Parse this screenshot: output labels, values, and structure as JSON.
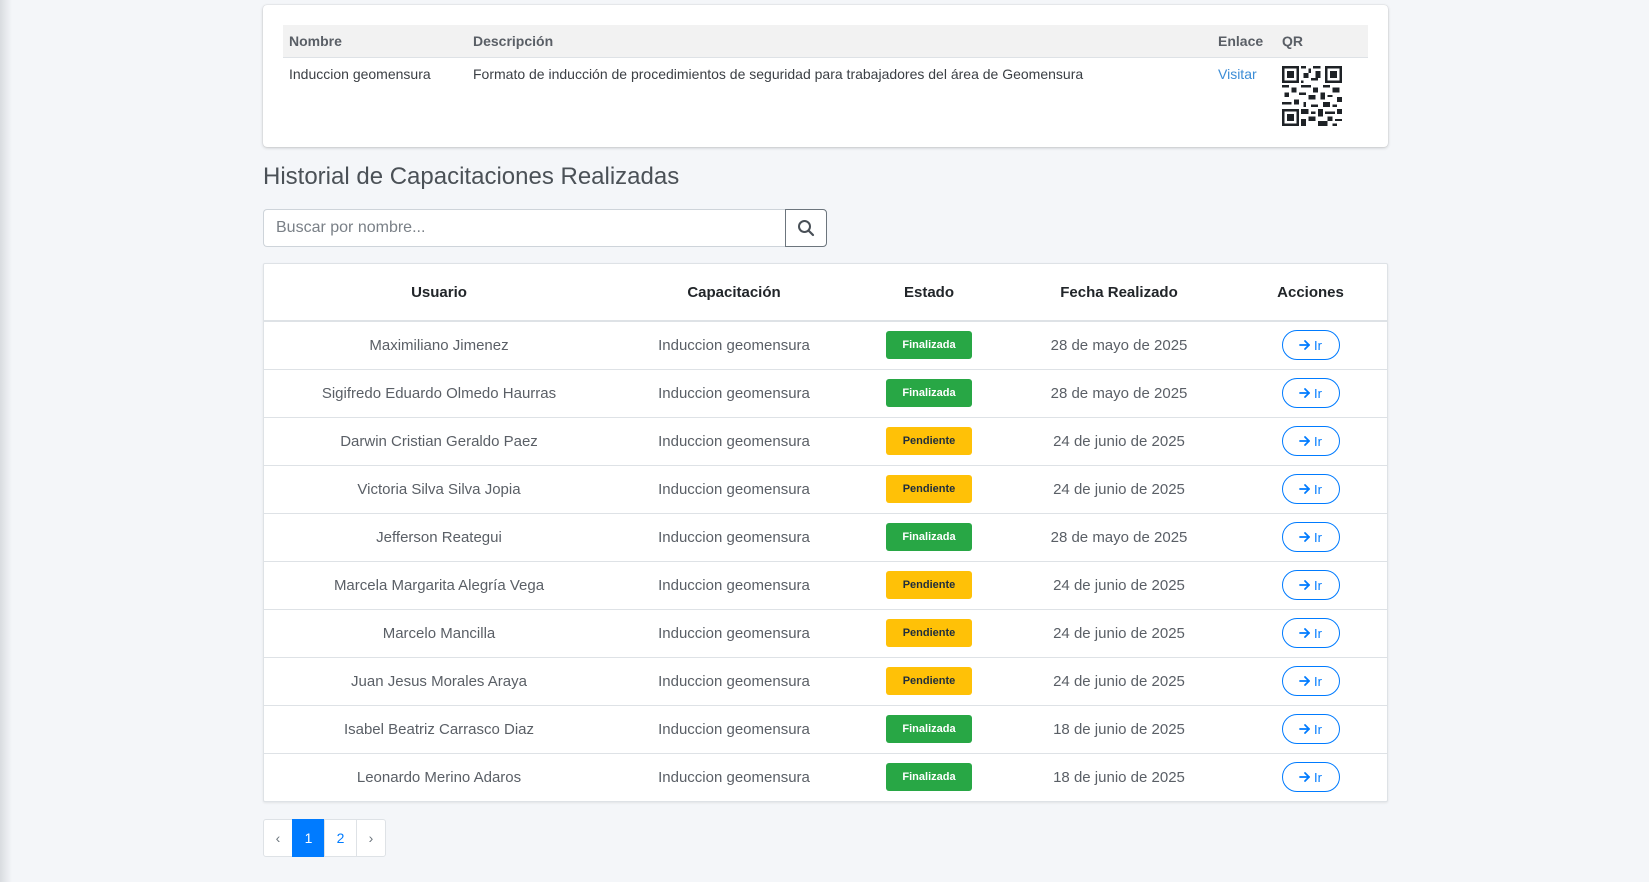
{
  "formato": {
    "headers": {
      "nombre": "Nombre",
      "descripcion": "Descripción",
      "enlace": "Enlace",
      "qr": "QR"
    },
    "row": {
      "nombre": "Induccion geomensura",
      "descripcion": "Formato de inducción de procedimientos de seguridad para trabajadores del área de Geomensura",
      "enlace": "Visitar"
    }
  },
  "historial": {
    "title": "Historial de Capacitaciones Realizadas",
    "search": {
      "placeholder": "Buscar por nombre...",
      "value": ""
    },
    "headers": {
      "usuario": "Usuario",
      "capacitacion": "Capacitación",
      "estado": "Estado",
      "fecha": "Fecha Realizado",
      "acciones": "Acciones"
    },
    "action_label": "Ir",
    "rows": [
      {
        "usuario": "Maximiliano Jimenez",
        "capacitacion": "Induccion geomensura",
        "estado": "Finalizada",
        "fecha": "28 de mayo de 2025"
      },
      {
        "usuario": "Sigifredo Eduardo Olmedo Haurras",
        "capacitacion": "Induccion geomensura",
        "estado": "Finalizada",
        "fecha": "28 de mayo de 2025"
      },
      {
        "usuario": "Darwin Cristian Geraldo Paez",
        "capacitacion": "Induccion geomensura",
        "estado": "Pendiente",
        "fecha": "24 de junio de 2025"
      },
      {
        "usuario": "Victoria Silva Silva Jopia",
        "capacitacion": "Induccion geomensura",
        "estado": "Pendiente",
        "fecha": "24 de junio de 2025"
      },
      {
        "usuario": "Jefferson Reategui",
        "capacitacion": "Induccion geomensura",
        "estado": "Finalizada",
        "fecha": "28 de mayo de 2025"
      },
      {
        "usuario": "Marcela Margarita Alegría Vega",
        "capacitacion": "Induccion geomensura",
        "estado": "Pendiente",
        "fecha": "24 de junio de 2025"
      },
      {
        "usuario": "Marcelo Mancilla",
        "capacitacion": "Induccion geomensura",
        "estado": "Pendiente",
        "fecha": "24 de junio de 2025"
      },
      {
        "usuario": "Juan Jesus Morales Araya",
        "capacitacion": "Induccion geomensura",
        "estado": "Pendiente",
        "fecha": "24 de junio de 2025"
      },
      {
        "usuario": "Isabel Beatriz Carrasco Diaz",
        "capacitacion": "Induccion geomensura",
        "estado": "Finalizada",
        "fecha": "18 de junio de 2025"
      },
      {
        "usuario": "Leonardo Merino Adaros",
        "capacitacion": "Induccion geomensura",
        "estado": "Finalizada",
        "fecha": "18 de junio de 2025"
      }
    ]
  },
  "pagination": {
    "prev": "‹",
    "pages": [
      "1",
      "2"
    ],
    "active": "1",
    "next": "›"
  },
  "colors": {
    "success": "#28a745",
    "warning": "#ffc107",
    "primary": "#007bff",
    "link": "#3c8dd6"
  },
  "icons": {
    "search": "search-icon",
    "action": "arrow-right-icon",
    "qr": "qr-code-icon"
  }
}
